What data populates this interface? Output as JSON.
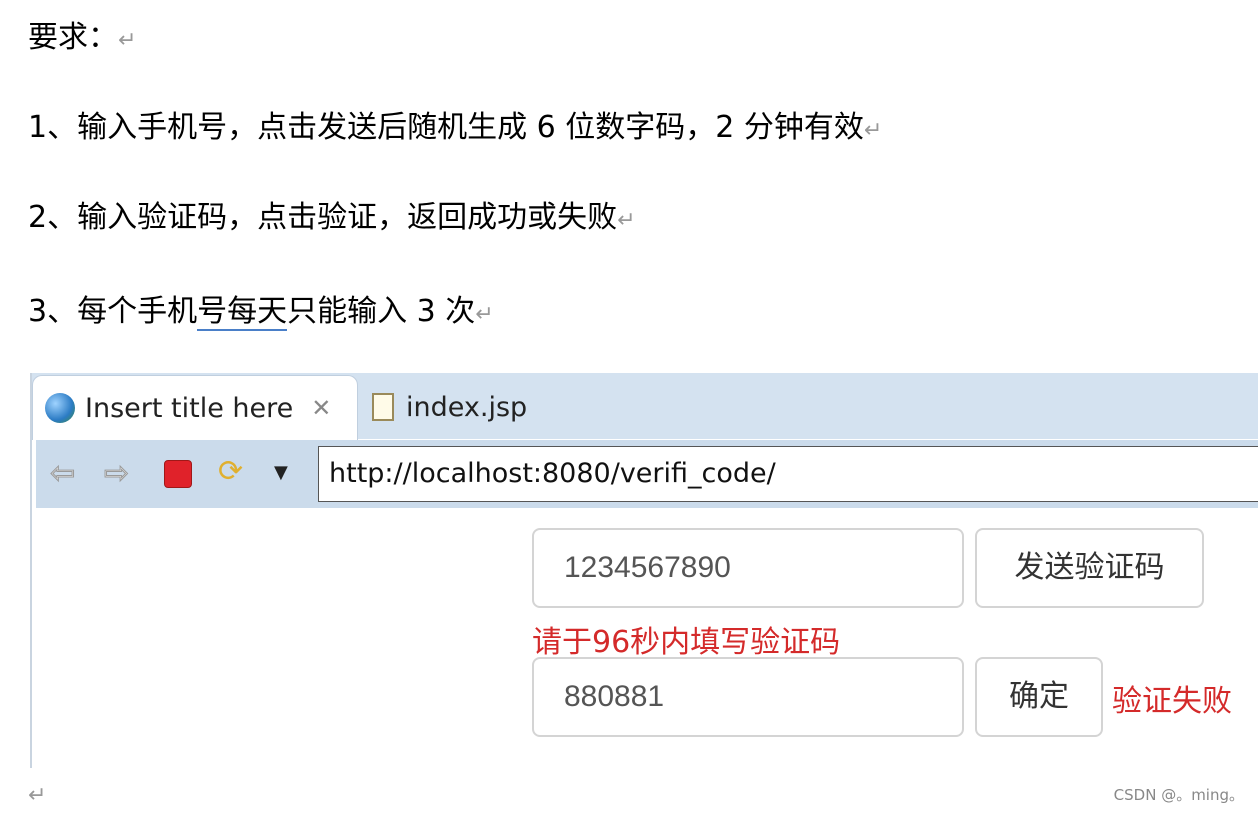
{
  "doc": {
    "heading": "要求：",
    "requirements": [
      "1、输入手机号，点击发送后随机生成 6 位数字码，2 分钟有效",
      "2、输入验证码，点击验证，返回成功或失败"
    ],
    "req3_prefix": "3、每个手机",
    "req3_underlined": "号每天",
    "req3_suffix": "只能输入 3 次",
    "paragraph_mark": "↵"
  },
  "browser": {
    "tabs": [
      {
        "label": "Insert title here",
        "icon": "globe-icon",
        "active": true
      },
      {
        "label": "index.jsp",
        "icon": "file-icon",
        "active": false
      }
    ],
    "url": "http://localhost:8080/verifi_code/"
  },
  "form": {
    "phone_value": "1234567890",
    "send_button": "发送验证码",
    "countdown_message": "请于96秒内填写验证码",
    "code_value": "880881",
    "confirm_button": "确定",
    "result": "验证失败",
    "error_color": "#d42a2a"
  },
  "watermark": "CSDN @。ming。"
}
